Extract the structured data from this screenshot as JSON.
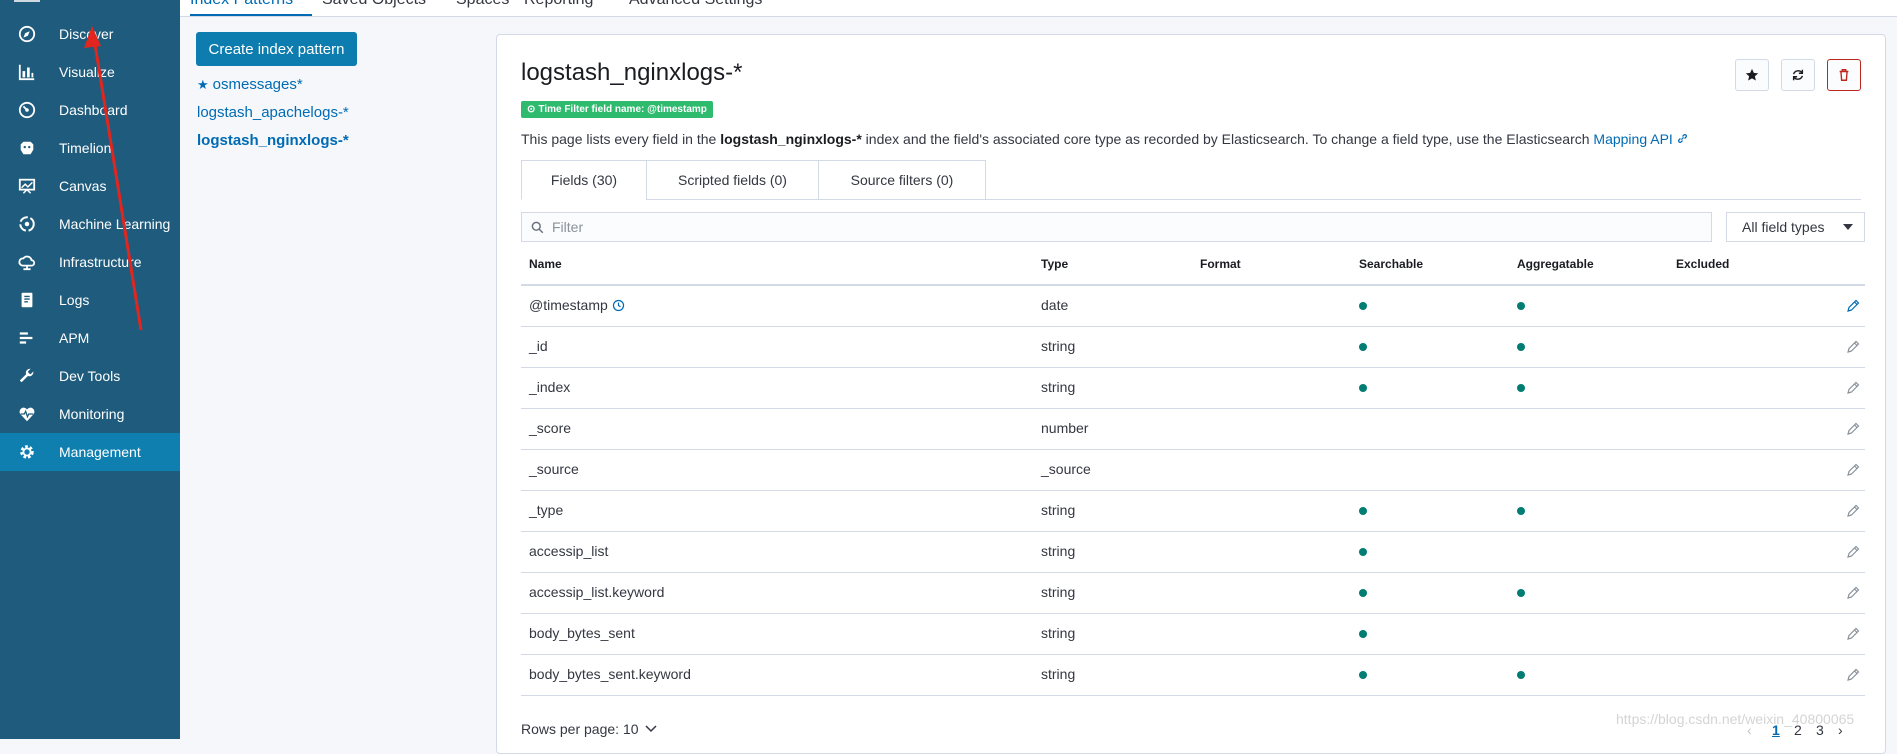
{
  "sidebar": {
    "items": [
      {
        "label": "Discover",
        "icon": "compass-icon"
      },
      {
        "label": "Visualize",
        "icon": "bar-chart-icon"
      },
      {
        "label": "Dashboard",
        "icon": "dashboard-icon"
      },
      {
        "label": "Timelion",
        "icon": "timelion-icon"
      },
      {
        "label": "Canvas",
        "icon": "canvas-icon"
      },
      {
        "label": "Machine Learning",
        "icon": "machine-learning-icon"
      },
      {
        "label": "Infrastructure",
        "icon": "infrastructure-icon"
      },
      {
        "label": "Logs",
        "icon": "logs-icon"
      },
      {
        "label": "APM",
        "icon": "apm-icon"
      },
      {
        "label": "Dev Tools",
        "icon": "wrench-icon"
      },
      {
        "label": "Monitoring",
        "icon": "heartbeat-icon"
      },
      {
        "label": "Management",
        "icon": "gear-icon"
      }
    ],
    "active": "Management"
  },
  "top_tabs": [
    "Index Patterns",
    "Saved Objects",
    "Spaces",
    "Reporting",
    "Advanced Settings"
  ],
  "create_button": "Create index pattern",
  "index_patterns": [
    {
      "name": "osmessages*",
      "default": true
    },
    {
      "name": "logstash_apachelogs-*",
      "default": false
    },
    {
      "name": "logstash_nginxlogs-*",
      "default": false,
      "selected": true
    }
  ],
  "panel": {
    "title": "logstash_nginxlogs-*",
    "time_badge": "Time Filter field name: @timestamp",
    "desc_pre": "This page lists every field in the ",
    "desc_bold": "logstash_nginxlogs-*",
    "desc_post": " index and the field's associated core type as recorded by Elasticsearch. To change a field type, use the Elasticsearch ",
    "desc_link": "Mapping API",
    "tabs": [
      "Fields (30)",
      "Scripted fields (0)",
      "Source filters (0)"
    ],
    "filter_placeholder": "Filter",
    "type_select": "All field types",
    "columns": [
      "Name",
      "Type",
      "Format",
      "Searchable",
      "Aggregatable",
      "Excluded"
    ],
    "rows": [
      {
        "name": "@timestamp",
        "type": "date",
        "searchable": true,
        "aggregatable": true,
        "time_field": true
      },
      {
        "name": "_id",
        "type": "string",
        "searchable": true,
        "aggregatable": true
      },
      {
        "name": "_index",
        "type": "string",
        "searchable": true,
        "aggregatable": true
      },
      {
        "name": "_score",
        "type": "number",
        "searchable": false,
        "aggregatable": false
      },
      {
        "name": "_source",
        "type": "_source",
        "searchable": false,
        "aggregatable": false
      },
      {
        "name": "_type",
        "type": "string",
        "searchable": true,
        "aggregatable": true
      },
      {
        "name": "accessip_list",
        "type": "string",
        "searchable": true,
        "aggregatable": false
      },
      {
        "name": "accessip_list.keyword",
        "type": "string",
        "searchable": true,
        "aggregatable": true
      },
      {
        "name": "body_bytes_sent",
        "type": "string",
        "searchable": true,
        "aggregatable": false
      },
      {
        "name": "body_bytes_sent.keyword",
        "type": "string",
        "searchable": true,
        "aggregatable": true
      }
    ],
    "rows_per_page": "Rows per page: 10",
    "pages": [
      "1",
      "2",
      "3"
    ],
    "current_page": "1"
  },
  "watermark": "https://blog.csdn.net/weixin_40800065",
  "colors": {
    "sidebar": "#1e5b7c",
    "sidebar_active": "#0f7fb0",
    "primary": "#006bb4",
    "dot": "#017d73",
    "danger": "#bd271e",
    "badge": "#2ebb6e",
    "arrow": "#e0261f"
  }
}
